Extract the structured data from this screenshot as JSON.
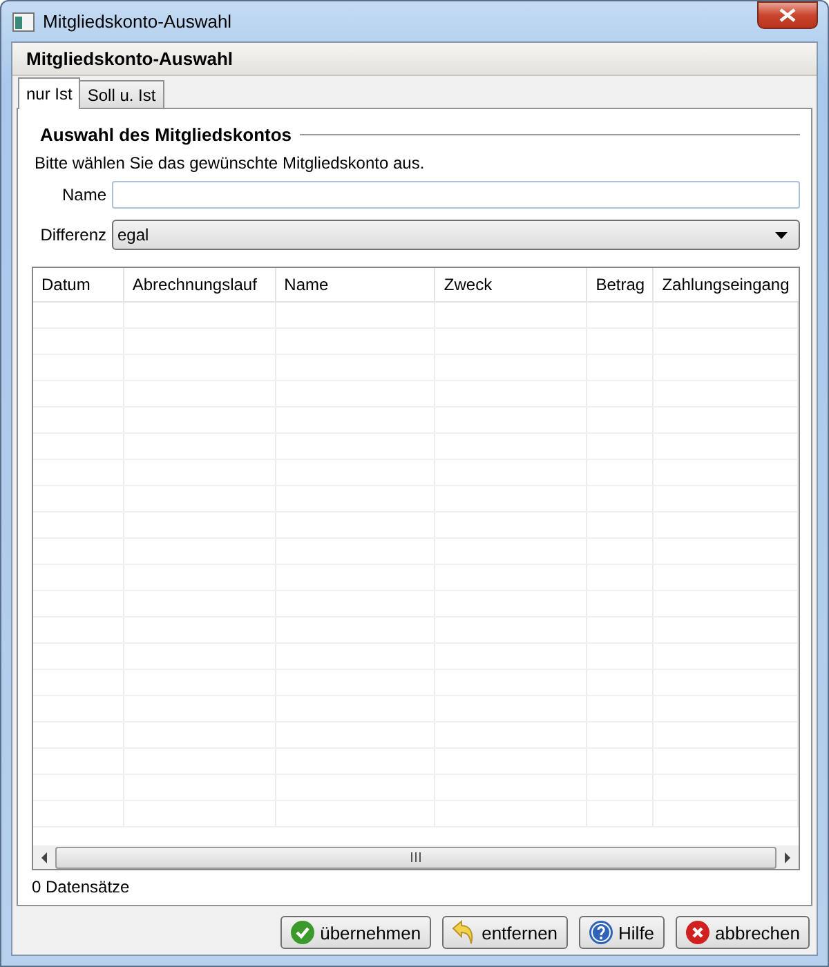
{
  "window": {
    "title": "Mitgliedskonto-Auswahl"
  },
  "panel_title": "Mitgliedskonto-Auswahl",
  "tabs": [
    {
      "label": "nur Ist",
      "selected": true
    },
    {
      "label": "Soll u. Ist",
      "selected": false
    }
  ],
  "group_title": "Auswahl des Mitgliedskontos",
  "instruction": "Bitte wählen Sie das gewünschte Mitgliedskonto aus.",
  "fields": [
    {
      "kind": "text",
      "label": "Name"
    },
    {
      "kind": "select",
      "label": "Differenz",
      "value": "egal"
    }
  ],
  "table": {
    "columns": [
      "Datum",
      "Abrechnungslauf",
      "Name",
      "Zweck",
      "Betrag",
      "Zahlungseingang"
    ]
  },
  "record_count": "0 Datensätze",
  "buttons": [
    {
      "kind": "ok",
      "label": "übernehmen"
    },
    {
      "kind": "remove",
      "label": "entfernen"
    },
    {
      "kind": "help",
      "label": "Hilfe"
    },
    {
      "kind": "cancel",
      "label": "abbrechen"
    }
  ]
}
